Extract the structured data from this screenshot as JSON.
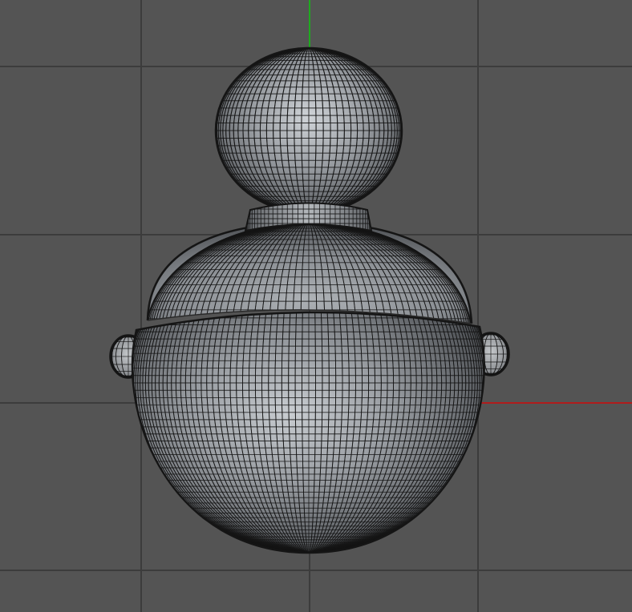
{
  "viewport": {
    "view": "front",
    "background_color": "#545454",
    "grid_color": "#3c3c3c",
    "grid_visible": true
  },
  "axes": {
    "x_axis": {
      "name": "x-axis",
      "color": "#b01c1c"
    },
    "y_axis": {
      "name": "y-axis",
      "color": "#1faa1f"
    }
  },
  "model": {
    "object": "gourd-mesh",
    "display_mode": "wireframe-on-shaded",
    "surface_color": "#8f9398",
    "highlight_color": "#d2d6da",
    "wire_color": "#141414",
    "parts": [
      "top-bulb",
      "neck-ring",
      "body-upper-cap",
      "body-lower-sphere",
      "left-handle",
      "right-handle"
    ]
  }
}
